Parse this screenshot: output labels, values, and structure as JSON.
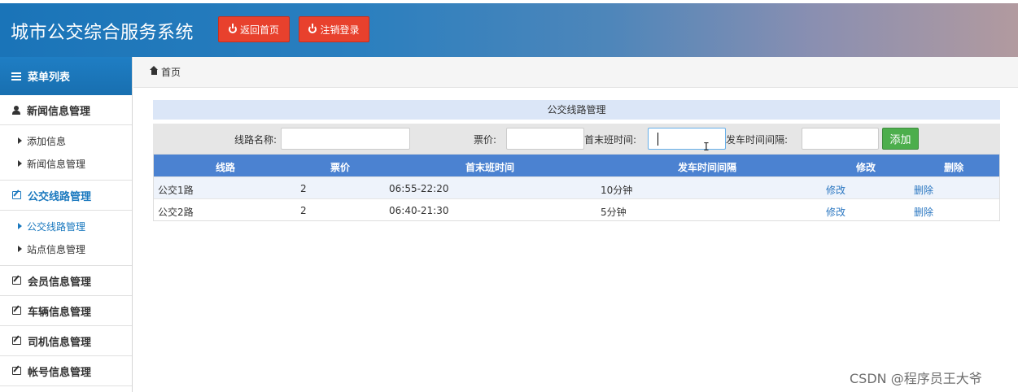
{
  "header": {
    "title": "城市公交综合服务系统",
    "home_button": "返回首页",
    "logout_button": "注销登录"
  },
  "sidebar": {
    "menu_title": "菜单列表",
    "groups": [
      {
        "label": "新闻信息管理",
        "icon": "user-icon",
        "items": [
          "添加信息",
          "新闻信息管理"
        ]
      },
      {
        "label": "公交线路管理",
        "icon": "edit-icon",
        "active": true,
        "items": [
          "公交线路管理",
          "站点信息管理"
        ]
      },
      {
        "label": "会员信息管理",
        "icon": "edit-icon"
      },
      {
        "label": "车辆信息管理",
        "icon": "edit-icon"
      },
      {
        "label": "司机信息管理",
        "icon": "edit-icon"
      },
      {
        "label": "帐号信息管理",
        "icon": "edit-icon"
      }
    ]
  },
  "breadcrumb": {
    "label": "首页"
  },
  "panel": {
    "title": "公交线路管理",
    "search": {
      "route_name_label": "线路名称:",
      "route_name_value": "",
      "fare_label": "票价:",
      "fare_value": "",
      "time_label": "首末班时间:",
      "time_value": "",
      "interval_label": "发车时间间隔:",
      "interval_value": "",
      "add_button": "添加"
    },
    "table": {
      "headers": [
        "线路",
        "票价",
        "首末班时间",
        "发车时间间隔",
        "修改",
        "删除"
      ],
      "rows": [
        [
          "公交1路",
          "2",
          "06:55-22:20",
          "10分钟",
          "修改",
          "删除"
        ],
        [
          "公交2路",
          "2",
          "06:40-21:30",
          "5分钟",
          "修改",
          "删除"
        ]
      ]
    }
  },
  "watermark": "CSDN @程序员王大爷"
}
